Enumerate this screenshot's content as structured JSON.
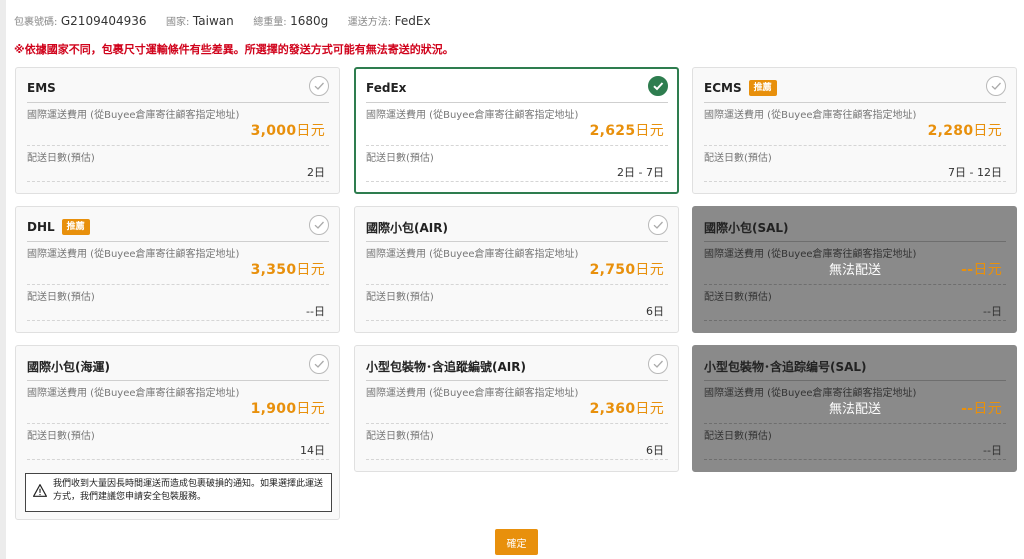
{
  "info": {
    "package_label": "包裹號碼:",
    "package_value": "G2109404936",
    "country_label": "國家:",
    "country_value": "Taiwan",
    "weight_label": "總重量:",
    "weight_value": "1680g",
    "method_label": "運送方法:",
    "method_value": "FedEx"
  },
  "notice": "※依據國家不同，包裹尺寸運輸條件有些差異。所選擇的發送方式可能有無法寄送的狀況。",
  "labels": {
    "fee": "國際運送費用 (從Buyee倉庫寄往顧客指定地址)",
    "days": "配送日數(預估)",
    "yen": "日元"
  },
  "cards": [
    {
      "name": "EMS",
      "badge": "",
      "price": "3,000",
      "days": "2日",
      "available": "yes",
      "selected": "no"
    },
    {
      "name": "FedEx",
      "badge": "",
      "price": "2,625",
      "days": "2日 - 7日",
      "available": "yes",
      "selected": "yes"
    },
    {
      "name": "ECMS",
      "badge": "推薦",
      "price": "2,280",
      "days": "7日 - 12日",
      "available": "yes",
      "selected": "no"
    },
    {
      "name": "DHL",
      "badge": "推薦",
      "price": "3,350",
      "days": "--日",
      "available": "yes",
      "selected": "no"
    },
    {
      "name": "國際小包(AIR)",
      "badge": "",
      "price": "2,750",
      "days": "6日",
      "available": "yes",
      "selected": "no"
    },
    {
      "name": "國際小包(SAL)",
      "badge": "",
      "price": "--",
      "days": "--日",
      "available": "no",
      "unavailable_text": "無法配送",
      "selected": "no"
    },
    {
      "name": "國際小包(海運)",
      "badge": "",
      "price": "1,900",
      "days": "14日",
      "available": "yes",
      "selected": "no"
    },
    {
      "name": "小型包裝物･含追蹤編號(AIR)",
      "badge": "",
      "price": "2,360",
      "days": "6日",
      "available": "yes",
      "selected": "no"
    },
    {
      "name": "小型包裝物･含追踪编号(SAL)",
      "badge": "",
      "price": "--",
      "days": "--日",
      "available": "no",
      "unavailable_text": "無法配送",
      "selected": "no"
    }
  ],
  "warning": "我們收到大量因長時間運送而造成包裹破損的通知。如果選擇此運送方式，我們建議您申請安全包裝服務。",
  "confirm_label": "確定",
  "colors": {
    "accent": "#e8900c",
    "selected": "#2e7d4f",
    "notice": "#d0021b",
    "disabled": "#8a8a8a"
  }
}
